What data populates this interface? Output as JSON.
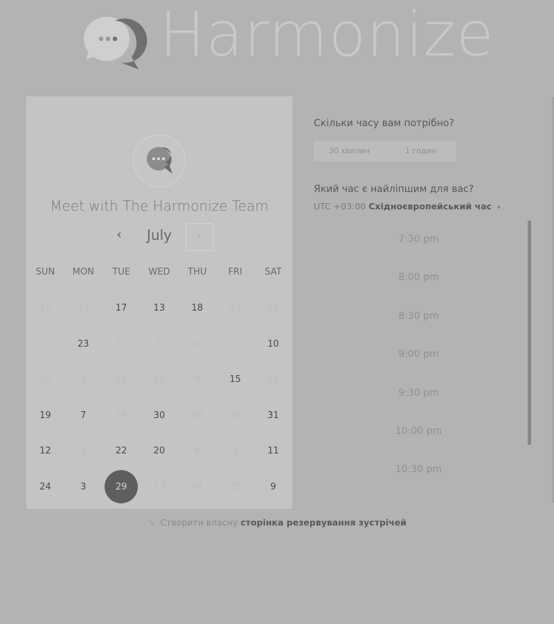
{
  "header": {
    "logo_text": "Harmonize",
    "logo_icon": "speech-bubble-icon"
  },
  "calendar": {
    "title": "Meet with The Harmonize Team",
    "month": "July",
    "prev_symbol": "‹",
    "next_symbol": "›",
    "weekdays": [
      "SUN",
      "MON",
      "TUE",
      "WED",
      "THU",
      "FRI",
      "SAT"
    ],
    "weeks": [
      [
        {
          "d": "10",
          "s": "inactive"
        },
        {
          "d": "17",
          "s": "inactive"
        },
        {
          "d": "17",
          "s": "active"
        },
        {
          "d": "13",
          "s": "active"
        },
        {
          "d": "18",
          "s": "active"
        },
        {
          "d": "24",
          "s": "inactive"
        },
        {
          "d": "21",
          "s": "inactive"
        }
      ],
      [
        {
          "d": "2",
          "s": "inactive"
        },
        {
          "d": "23",
          "s": "active"
        },
        {
          "d": "27",
          "s": "inactive"
        },
        {
          "d": "5",
          "s": "inactive"
        },
        {
          "d": "4",
          "s": "inactive"
        },
        {
          "d": "1",
          "s": "inactive"
        },
        {
          "d": "10",
          "s": "active"
        }
      ],
      [
        {
          "d": "26",
          "s": "inactive"
        },
        {
          "d": "2",
          "s": "inactive"
        },
        {
          "d": "20",
          "s": "inactive"
        },
        {
          "d": "30",
          "s": "inactive"
        },
        {
          "d": "9",
          "s": "inactive"
        },
        {
          "d": "15",
          "s": "active"
        },
        {
          "d": "22",
          "s": "inactive"
        }
      ],
      [
        {
          "d": "19",
          "s": "active"
        },
        {
          "d": "7",
          "s": "active"
        },
        {
          "d": "14",
          "s": "inactive"
        },
        {
          "d": "30",
          "s": "active"
        },
        {
          "d": "18",
          "s": "inactive"
        },
        {
          "d": "25",
          "s": "inactive"
        },
        {
          "d": "31",
          "s": "active"
        }
      ],
      [
        {
          "d": "12",
          "s": "active"
        },
        {
          "d": "5",
          "s": "inactive"
        },
        {
          "d": "22",
          "s": "active"
        },
        {
          "d": "20",
          "s": "active"
        },
        {
          "d": "6",
          "s": "inactive"
        },
        {
          "d": "2",
          "s": "inactive"
        },
        {
          "d": "11",
          "s": "active"
        }
      ],
      [
        {
          "d": "24",
          "s": "active"
        },
        {
          "d": "3",
          "s": "active"
        },
        {
          "d": "29",
          "s": "selected"
        },
        {
          "d": "13",
          "s": "inactive"
        },
        {
          "d": "14",
          "s": "inactive"
        },
        {
          "d": "25",
          "s": "inactive"
        },
        {
          "d": "9",
          "s": "active"
        }
      ]
    ]
  },
  "booking": {
    "duration_question": "Скільки часу вам потрібно?",
    "duration_options": [
      "30 хвилин",
      "1 годин"
    ],
    "time_question": "Який час є найліпшим для вас?",
    "timezone_offset": "UTC +03:00",
    "timezone_name": "Східноєвропейський час",
    "timezone_caret": "▾",
    "slots": [
      "7:30 pm",
      "8:00 pm",
      "8:30 pm",
      "9:00 pm",
      "9:30 pm",
      "10:00 pm",
      "10:30 pm"
    ]
  },
  "footer": {
    "arrow": "↘",
    "text": "Створити власну",
    "link": "сторінка резервування зустрічей"
  },
  "colors": {
    "background": "#b3b3b3",
    "card": "#c4c4c4",
    "selected_day": "#5e5e5e"
  }
}
